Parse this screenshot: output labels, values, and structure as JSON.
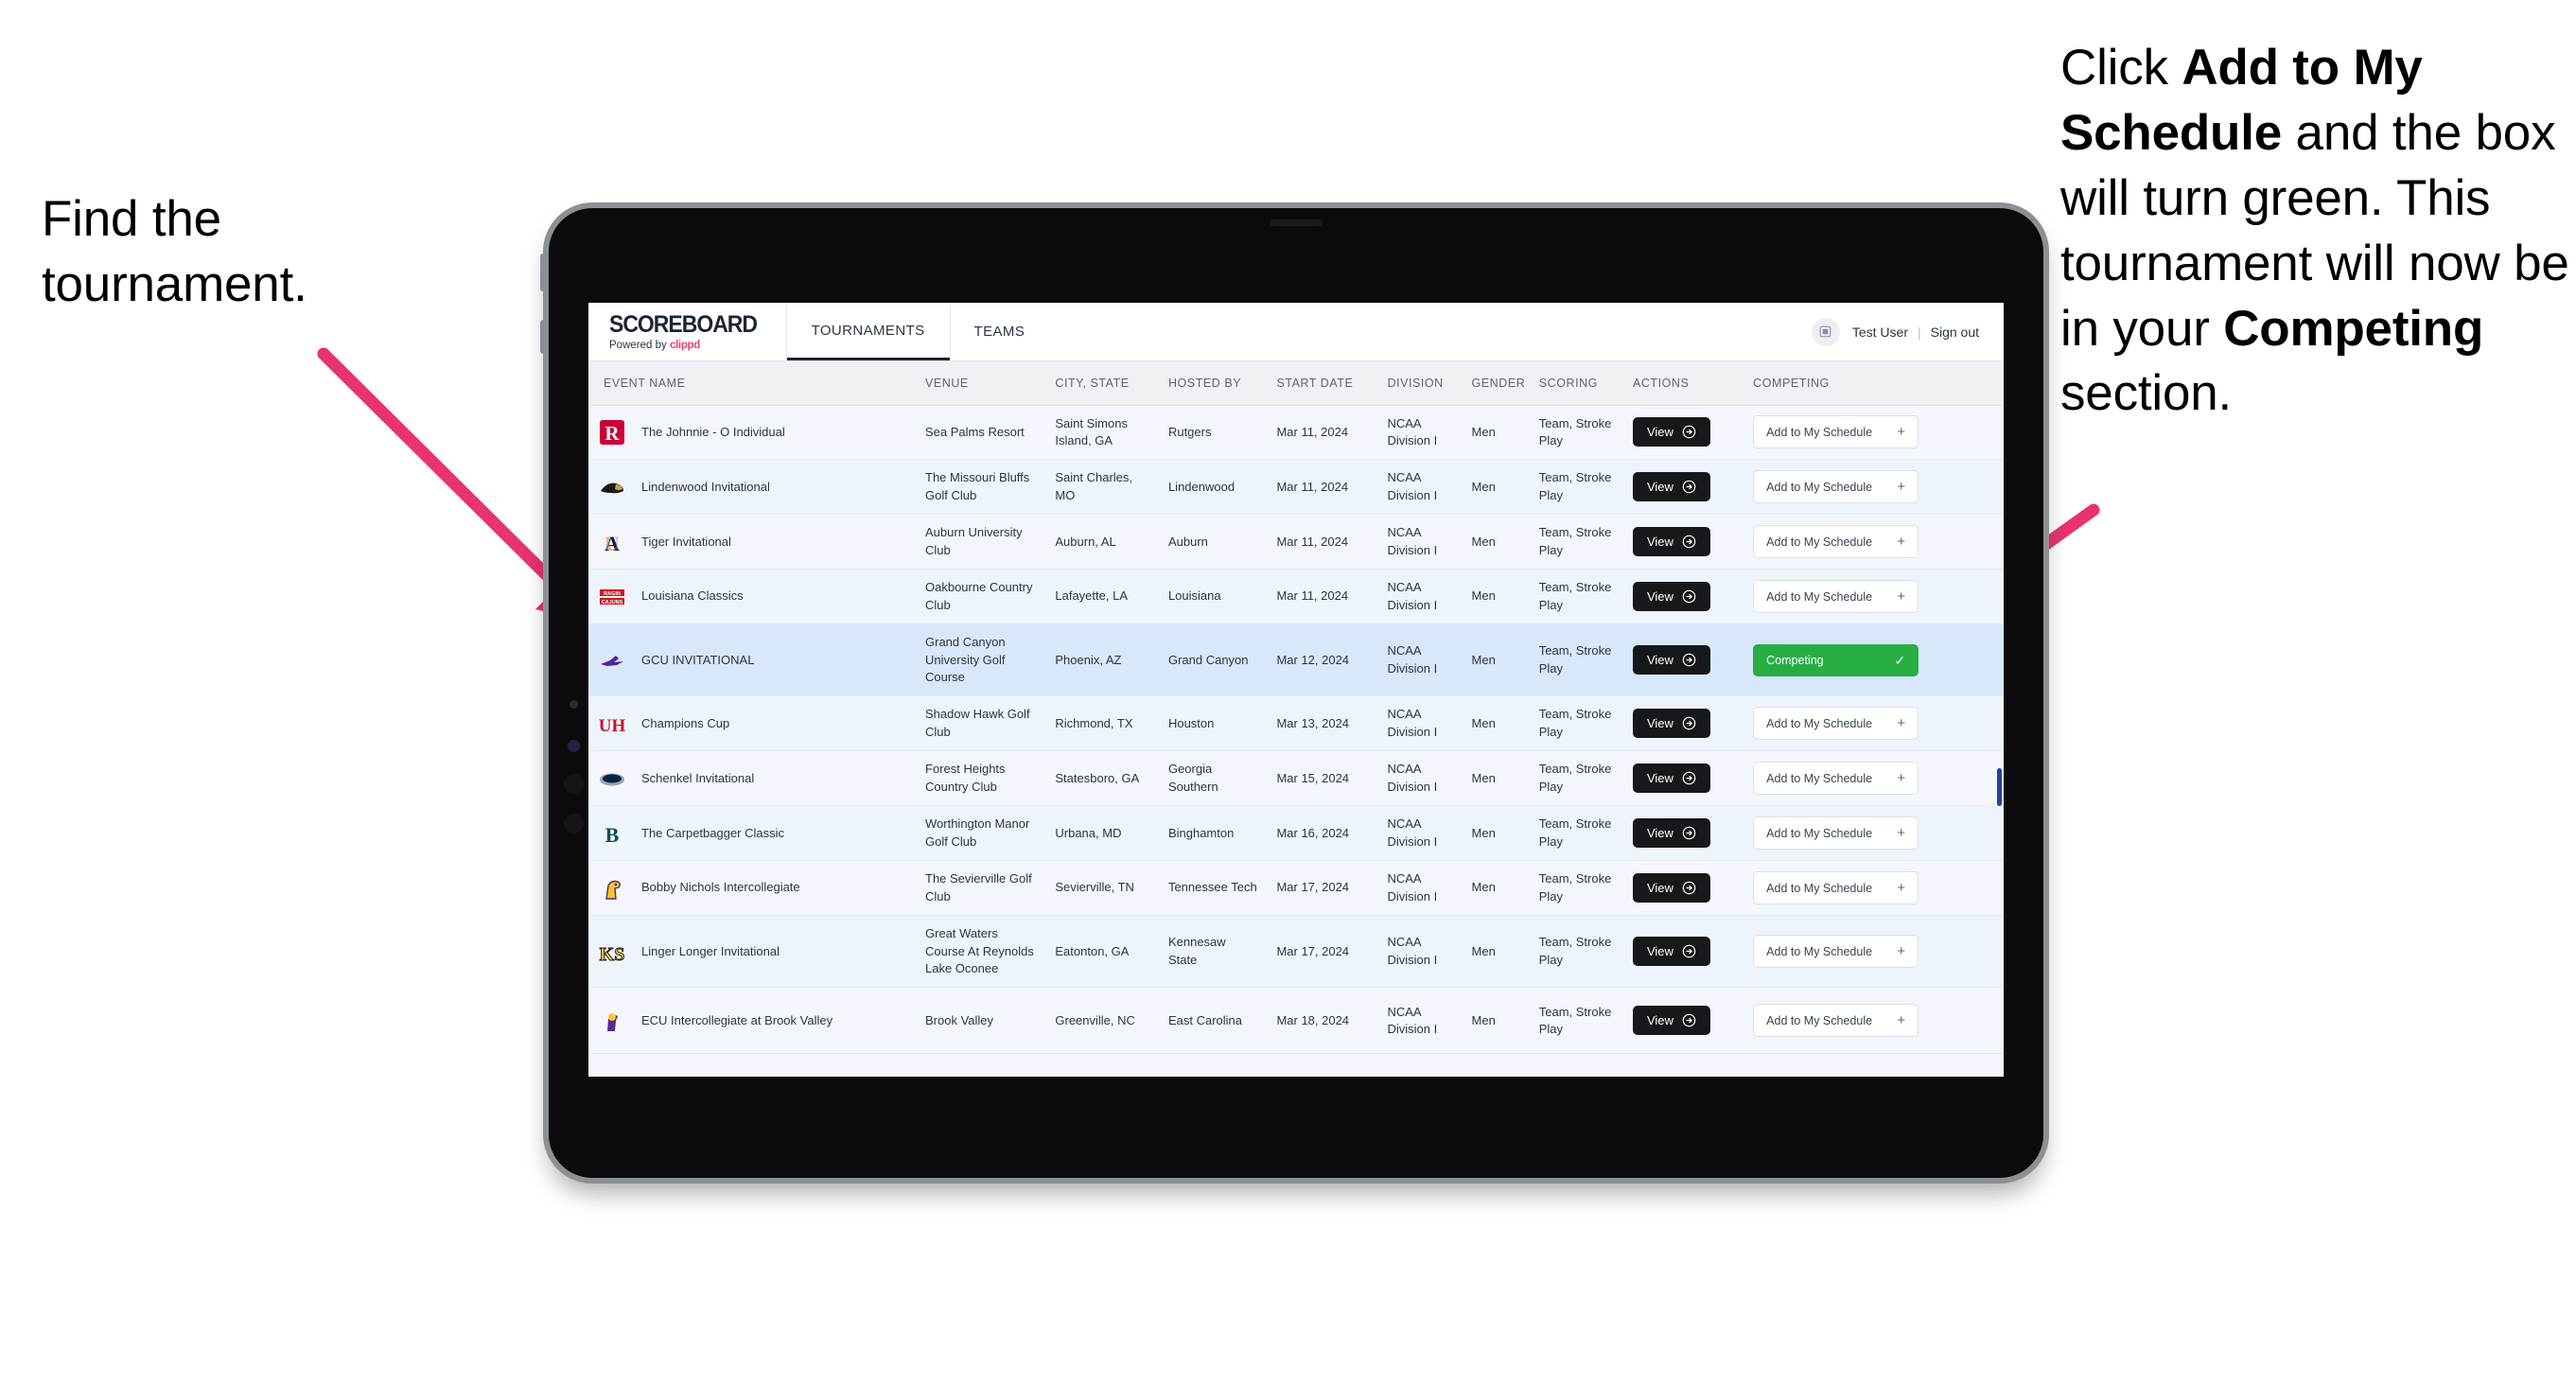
{
  "annotations": {
    "left": {
      "line1": "Find the",
      "line2": "tournament."
    },
    "right": {
      "seg1": "Click ",
      "bold1": "Add to My Schedule",
      "seg2": " and the box will turn green. This tournament will now be in your ",
      "bold2": "Competing",
      "seg3": " section."
    },
    "arrow_color": "#e8336d"
  },
  "app": {
    "brand": {
      "title": "SCOREBOARD",
      "powered_prefix": "Powered by ",
      "powered_name": "clippd"
    },
    "tabs": [
      {
        "label": "TOURNAMENTS",
        "active": true
      },
      {
        "label": "TEAMS",
        "active": false
      }
    ],
    "user": {
      "avatar_icon": "user-avatar-icon",
      "name": "Test User",
      "separator": "|",
      "signout": "Sign out"
    }
  },
  "table": {
    "columns": [
      "EVENT NAME",
      "VENUE",
      "CITY, STATE",
      "HOSTED BY",
      "START DATE",
      "DIVISION",
      "GENDER",
      "SCORING",
      "ACTIONS",
      "COMPETING"
    ],
    "view_label": "View",
    "add_label": "Add to My Schedule",
    "competing_label": "Competing",
    "rows": [
      {
        "logo": "rutgers-logo",
        "event": "The Johnnie - O Individual",
        "venue": "Sea Palms Resort",
        "city": "Saint Simons Island, GA",
        "host": "Rutgers",
        "date": "Mar 11, 2024",
        "division": "NCAA Division I",
        "gender": "Men",
        "scoring": "Team, Stroke Play",
        "competing": false
      },
      {
        "logo": "lindenwood-logo",
        "event": "Lindenwood Invitational",
        "venue": "The Missouri Bluffs Golf Club",
        "city": "Saint Charles, MO",
        "host": "Lindenwood",
        "date": "Mar 11, 2024",
        "division": "NCAA Division I",
        "gender": "Men",
        "scoring": "Team, Stroke Play",
        "competing": false
      },
      {
        "logo": "auburn-logo",
        "event": "Tiger Invitational",
        "venue": "Auburn University Club",
        "city": "Auburn, AL",
        "host": "Auburn",
        "date": "Mar 11, 2024",
        "division": "NCAA Division I",
        "gender": "Men",
        "scoring": "Team, Stroke Play",
        "competing": false
      },
      {
        "logo": "louisiana-ragin-cajuns-logo",
        "event": "Louisiana Classics",
        "venue": "Oakbourne Country Club",
        "city": "Lafayette, LA",
        "host": "Louisiana",
        "date": "Mar 11, 2024",
        "division": "NCAA Division I",
        "gender": "Men",
        "scoring": "Team, Stroke Play",
        "competing": false
      },
      {
        "logo": "grand-canyon-lopes-logo",
        "event": "GCU INVITATIONAL",
        "venue": "Grand Canyon University Golf Course",
        "city": "Phoenix, AZ",
        "host": "Grand Canyon",
        "date": "Mar 12, 2024",
        "division": "NCAA Division I",
        "gender": "Men",
        "scoring": "Team, Stroke Play",
        "competing": true,
        "highlight": true
      },
      {
        "logo": "houston-cougars-logo",
        "event": "Champions Cup",
        "venue": "Shadow Hawk Golf Club",
        "city": "Richmond, TX",
        "host": "Houston",
        "date": "Mar 13, 2024",
        "division": "NCAA Division I",
        "gender": "Men",
        "scoring": "Team, Stroke Play",
        "competing": false
      },
      {
        "logo": "georgia-southern-logo",
        "event": "Schenkel Invitational",
        "venue": "Forest Heights Country Club",
        "city": "Statesboro, GA",
        "host": "Georgia Southern",
        "date": "Mar 15, 2024",
        "division": "NCAA Division I",
        "gender": "Men",
        "scoring": "Team, Stroke Play",
        "competing": false
      },
      {
        "logo": "binghamton-bearcats-logo",
        "event": "The Carpetbagger Classic",
        "venue": "Worthington Manor Golf Club",
        "city": "Urbana, MD",
        "host": "Binghamton",
        "date": "Mar 16, 2024",
        "division": "NCAA Division I",
        "gender": "Men",
        "scoring": "Team, Stroke Play",
        "competing": false
      },
      {
        "logo": "tennessee-tech-golden-eagles-logo",
        "event": "Bobby Nichols Intercollegiate",
        "venue": "The Sevierville Golf Club",
        "city": "Sevierville, TN",
        "host": "Tennessee Tech",
        "date": "Mar 17, 2024",
        "division": "NCAA Division I",
        "gender": "Men",
        "scoring": "Team, Stroke Play",
        "competing": false
      },
      {
        "logo": "kennesaw-state-owls-logo",
        "event": "Linger Longer Invitational",
        "venue": "Great Waters Course At Reynolds Lake Oconee",
        "city": "Eatonton, GA",
        "host": "Kennesaw State",
        "date": "Mar 17, 2024",
        "division": "NCAA Division I",
        "gender": "Men",
        "scoring": "Team, Stroke Play",
        "competing": false
      },
      {
        "logo": "east-carolina-pirates-logo",
        "event": "ECU Intercollegiate at Brook Valley",
        "venue": "Brook Valley",
        "city": "Greenville, NC",
        "host": "East Carolina",
        "date": "Mar 18, 2024",
        "division": "NCAA Division I",
        "gender": "Men",
        "scoring": "Team, Stroke Play",
        "competing": false,
        "partial": true
      }
    ]
  }
}
